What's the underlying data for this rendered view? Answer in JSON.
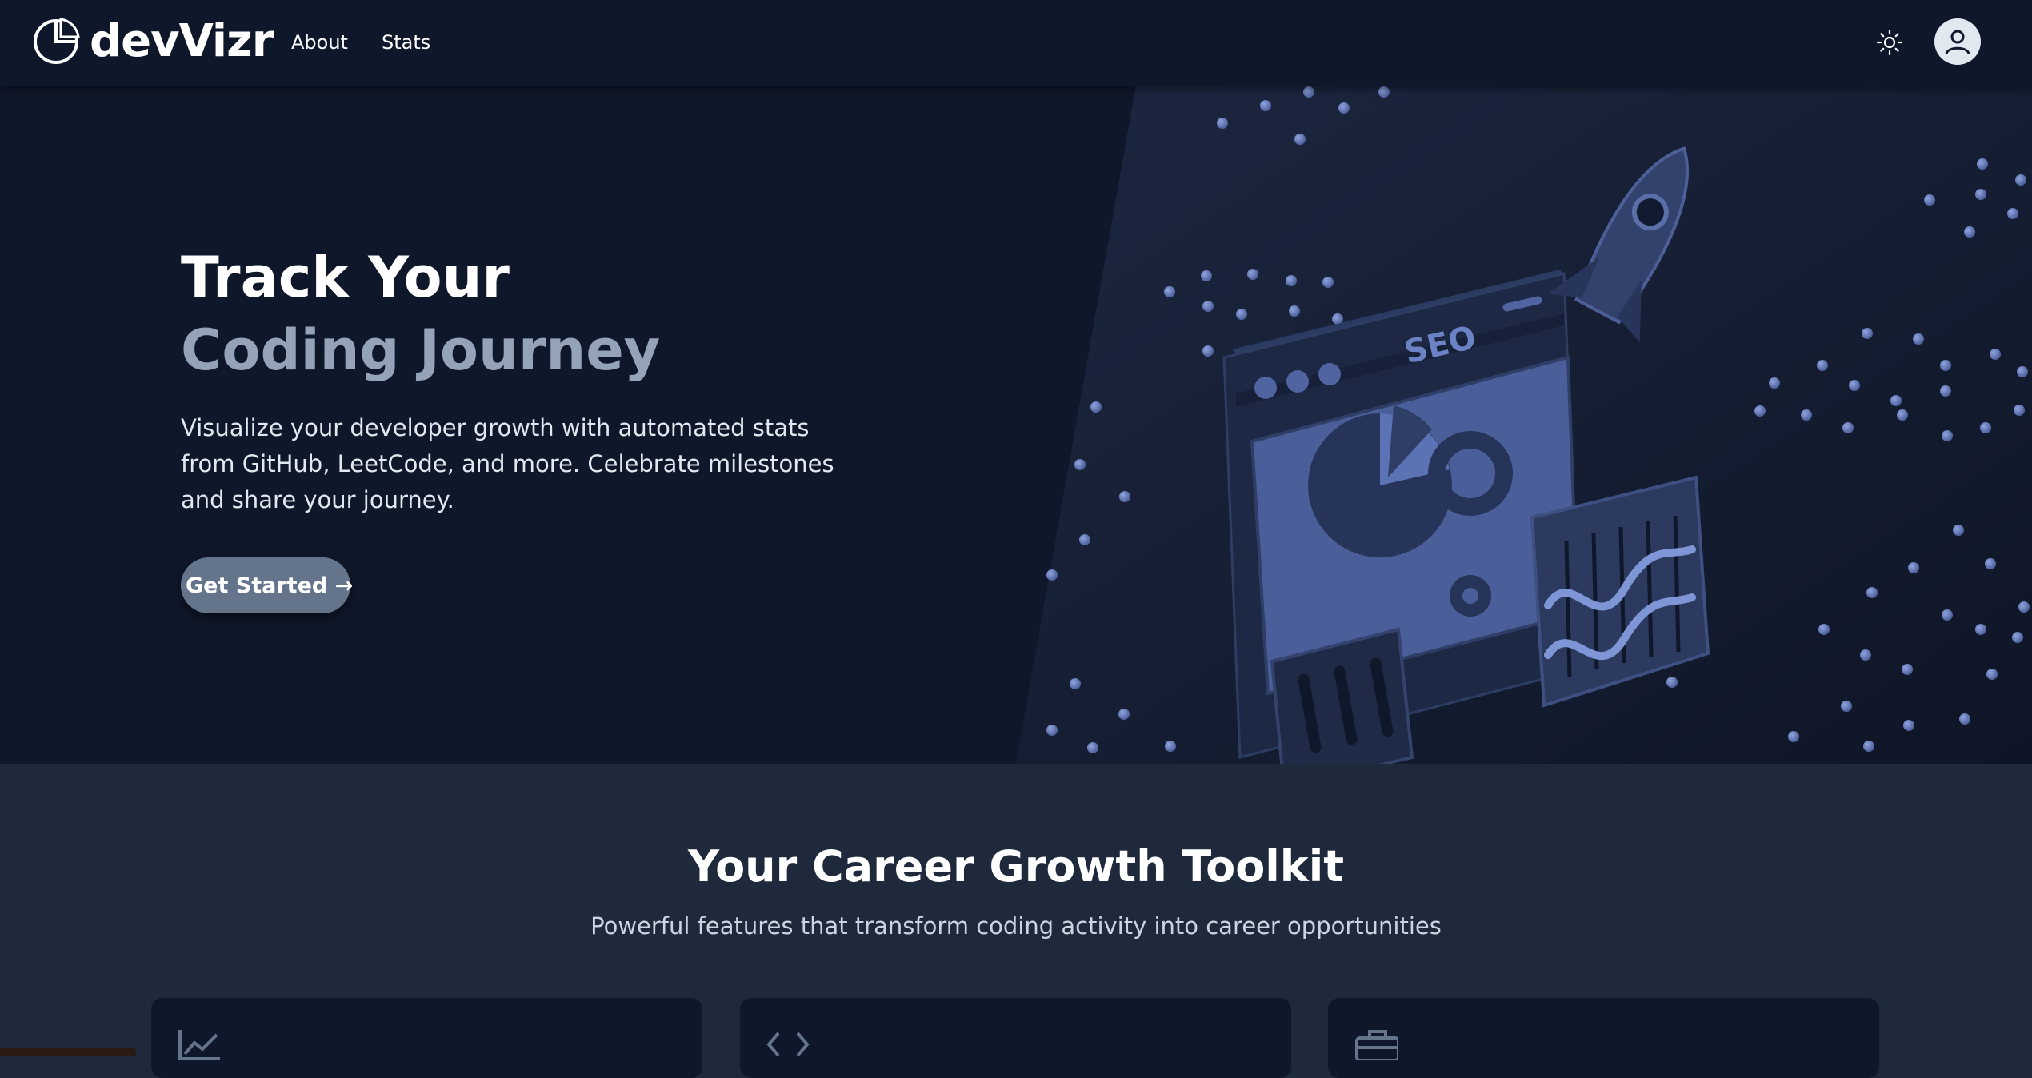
{
  "app": {
    "name": "devVizr",
    "logo_icon": "pie-chart-icon"
  },
  "nav": {
    "links": [
      "About",
      "Stats"
    ],
    "theme_icon": "sun-icon",
    "user_icon": "user-avatar-icon"
  },
  "hero": {
    "title_line1": "Track Your",
    "title_line2": "Coding Journey",
    "description": "Visualize your developer growth with automated stats from GitHub, LeetCode, and more. Celebrate milestones and share your journey.",
    "cta_label": "Get Started →",
    "illustration_label": "SEO"
  },
  "features": {
    "title": "Your Career Growth Toolkit",
    "subtitle": "Powerful features that transform coding activity into career opportunities",
    "cards": [
      {
        "icon": "trending-chart-icon"
      },
      {
        "icon": "code-brackets-icon"
      },
      {
        "icon": "briefcase-icon"
      }
    ]
  },
  "colors": {
    "nav_bg": "#0f172a",
    "hero_bg": "#0f172a",
    "section_bg": "#1e293b",
    "muted_title": "#94a3b8",
    "button_bg": "#64748b"
  }
}
